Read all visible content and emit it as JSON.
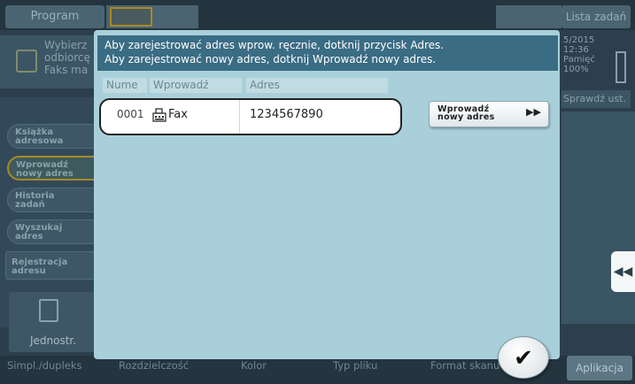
{
  "background": {
    "top_tabs": {
      "program": "Program",
      "lista_zadan": "Lista zadań"
    },
    "destination": {
      "text": "Wybierz\nodbiorcę\nFaks ma"
    },
    "status": {
      "info": "5/2015\n12:36\nPamięć\n100%",
      "sprawdz": "Sprawdź ust."
    },
    "left_buttons": {
      "ksiazka": "Książka\nadresowa",
      "wprowadz": "Wprowadź\nnowy adres",
      "historia": "Historia\nzadań",
      "wyszukaj": "Wyszukaj\nadres",
      "rejestracja": "Rejestracja\nadresu",
      "jednostr": "Jednostr."
    },
    "bottom_tabs": {
      "simpl": "Simpl./dupleks",
      "rozdzielczosc": "Rozdzielczość",
      "kolor": "Kolor",
      "typ_pliku": "Typ pliku",
      "format_skanu": "Format skanu",
      "aplikacja": "Aplikacja"
    },
    "scroll_arrow": "◀◀"
  },
  "dialog": {
    "message_line1": "Aby zarejestrować adres wprow. ręcznie, dotknij przycisk Adres.",
    "message_line2": "Aby zarejestrować nowy adres, dotknij Wprowadź nowy adres.",
    "columns": {
      "number": "Nume",
      "type": "Wprowadź",
      "address": "Adres"
    },
    "rows": [
      {
        "number": "0001",
        "type": "Fax",
        "address": "1234567890",
        "icon": "fax-icon"
      }
    ],
    "new_address_button": "Wprowadź\nnowy adres",
    "new_address_arrow": "▶▶",
    "ok_glyph": "✔"
  }
}
